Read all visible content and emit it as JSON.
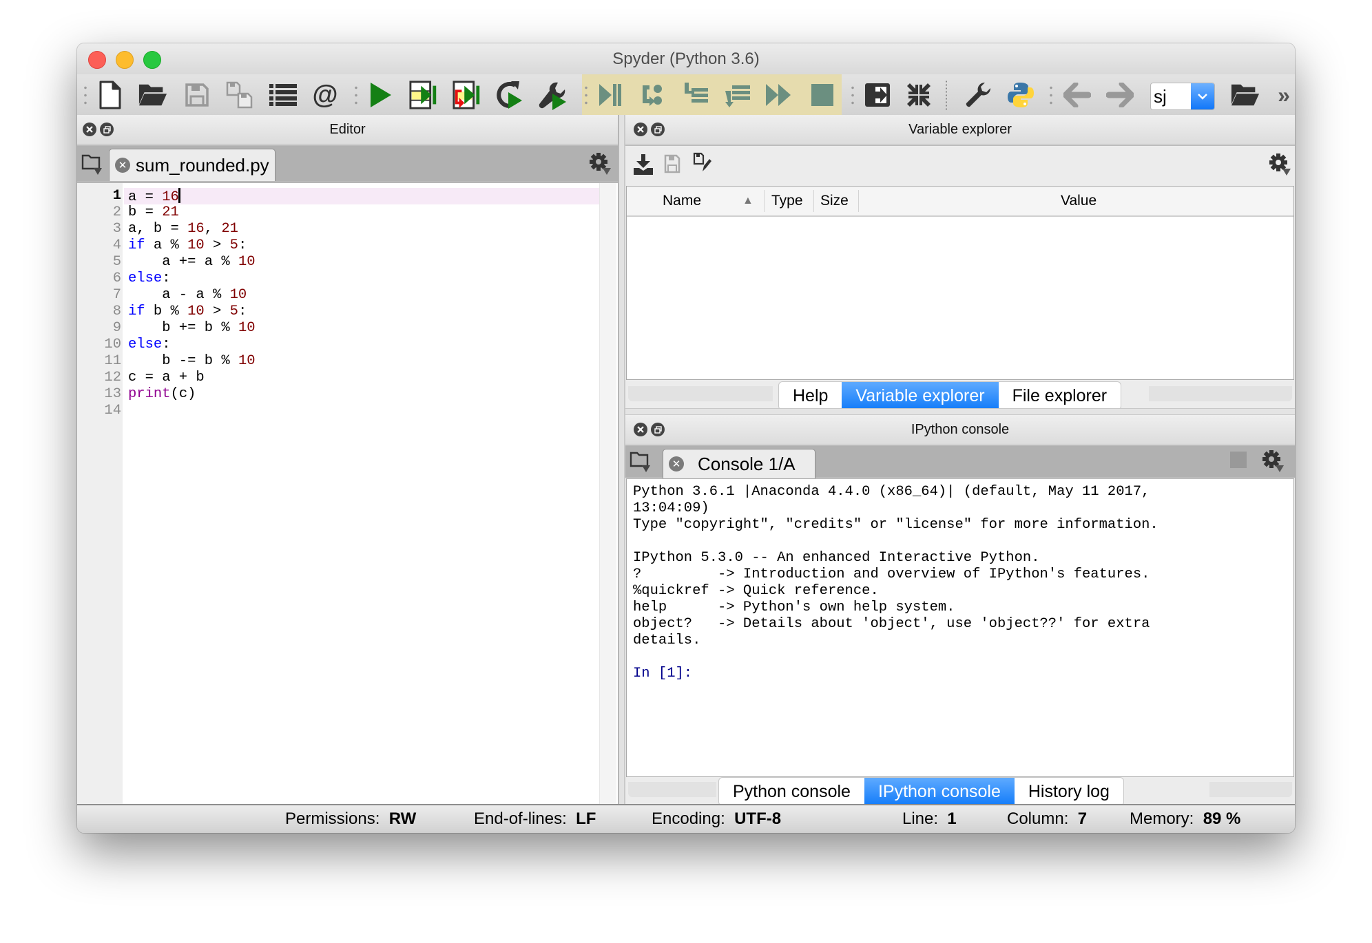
{
  "window": {
    "title": "Spyder (Python 3.6)"
  },
  "toolbar": {
    "icons": [
      "new-file",
      "open-file",
      "save-file",
      "save-all",
      "browse-tabs",
      "pythonpath-manager",
      "run-file",
      "run-cell",
      "run-cell-advance",
      "rerun-last",
      "run-configuration",
      "debug-file",
      "debug-step",
      "debug-step-into",
      "debug-step-return",
      "debug-continue",
      "debug-stop",
      "maximize-pane",
      "fullscreen",
      "preferences",
      "python-path",
      "back",
      "forward",
      "open-directory",
      "more"
    ],
    "working_dir": "sj",
    "more_label": "»"
  },
  "editor": {
    "title": "Editor",
    "tab_label": "sum_rounded.py",
    "current_line": 1,
    "lines": [
      {
        "n": "1",
        "tokens": [
          [
            "a = ",
            ""
          ],
          [
            "16",
            "num"
          ]
        ]
      },
      {
        "n": "2",
        "tokens": [
          [
            "b = ",
            ""
          ],
          [
            "21",
            "num"
          ]
        ]
      },
      {
        "n": "3",
        "tokens": [
          [
            "a, b = ",
            ""
          ],
          [
            "16",
            "num"
          ],
          [
            ", ",
            ""
          ],
          [
            "21",
            "num"
          ]
        ]
      },
      {
        "n": "4",
        "tokens": [
          [
            "if",
            "kw"
          ],
          [
            " a % ",
            ""
          ],
          [
            "10",
            "num"
          ],
          [
            " > ",
            ""
          ],
          [
            "5",
            "num"
          ],
          [
            ":",
            ""
          ]
        ]
      },
      {
        "n": "5",
        "tokens": [
          [
            "    a += a % ",
            ""
          ],
          [
            "10",
            "num"
          ]
        ]
      },
      {
        "n": "6",
        "tokens": [
          [
            "else",
            "kw"
          ],
          [
            ":",
            ""
          ]
        ]
      },
      {
        "n": "7",
        "tokens": [
          [
            "    a - a % ",
            ""
          ],
          [
            "10",
            "num"
          ]
        ]
      },
      {
        "n": "8",
        "tokens": [
          [
            "if",
            "kw"
          ],
          [
            " b % ",
            ""
          ],
          [
            "10",
            "num"
          ],
          [
            " > ",
            ""
          ],
          [
            "5",
            "num"
          ],
          [
            ":",
            ""
          ]
        ]
      },
      {
        "n": "9",
        "tokens": [
          [
            "    b += b % ",
            ""
          ],
          [
            "10",
            "num"
          ]
        ]
      },
      {
        "n": "10",
        "tokens": [
          [
            "else",
            "kw"
          ],
          [
            ":",
            ""
          ]
        ]
      },
      {
        "n": "11",
        "tokens": [
          [
            "    b -= b % ",
            ""
          ],
          [
            "10",
            "num"
          ]
        ]
      },
      {
        "n": "12",
        "tokens": [
          [
            "c = a + b",
            ""
          ]
        ]
      },
      {
        "n": "13",
        "tokens": [
          [
            "print",
            "bi"
          ],
          [
            "(c)",
            ""
          ]
        ]
      },
      {
        "n": "14",
        "tokens": []
      }
    ]
  },
  "variable_explorer": {
    "title": "Variable explorer",
    "columns": [
      "Name",
      "Type",
      "Size",
      "Value"
    ],
    "sort_indicator": "▲",
    "rows": []
  },
  "top_right_tabs": {
    "items": [
      "Help",
      "Variable explorer",
      "File explorer"
    ],
    "active": "Variable explorer"
  },
  "ipython": {
    "title": "IPython console",
    "tab_label": "Console 1/A",
    "output_lines": [
      "Python 3.6.1 |Anaconda 4.4.0 (x86_64)| (default, May 11 2017,",
      "13:04:09)",
      "Type \"copyright\", \"credits\" or \"license\" for more information.",
      "",
      "IPython 5.3.0 -- An enhanced Interactive Python.",
      "?         -> Introduction and overview of IPython's features.",
      "%quickref -> Quick reference.",
      "help      -> Python's own help system.",
      "object?   -> Details about 'object', use 'object??' for extra",
      "details.",
      ""
    ],
    "prompt": "In [1]:"
  },
  "bottom_right_tabs": {
    "items": [
      "Python console",
      "IPython console",
      "History log"
    ],
    "active": "IPython console"
  },
  "statusbar": {
    "permissions_label": "Permissions:",
    "permissions_value": "RW",
    "eol_label": "End-of-lines:",
    "eol_value": "LF",
    "encoding_label": "Encoding:",
    "encoding_value": "UTF-8",
    "line_label": "Line:",
    "line_value": "1",
    "column_label": "Column:",
    "column_value": "7",
    "memory_label": "Memory:",
    "memory_value": "89 %"
  },
  "colors": {
    "keyword": "#0000ff",
    "number": "#800000",
    "builtin": "#900090",
    "prompt": "#00008b",
    "active_tab": "#137cf9",
    "debug_highlight": "#e6dcae"
  }
}
